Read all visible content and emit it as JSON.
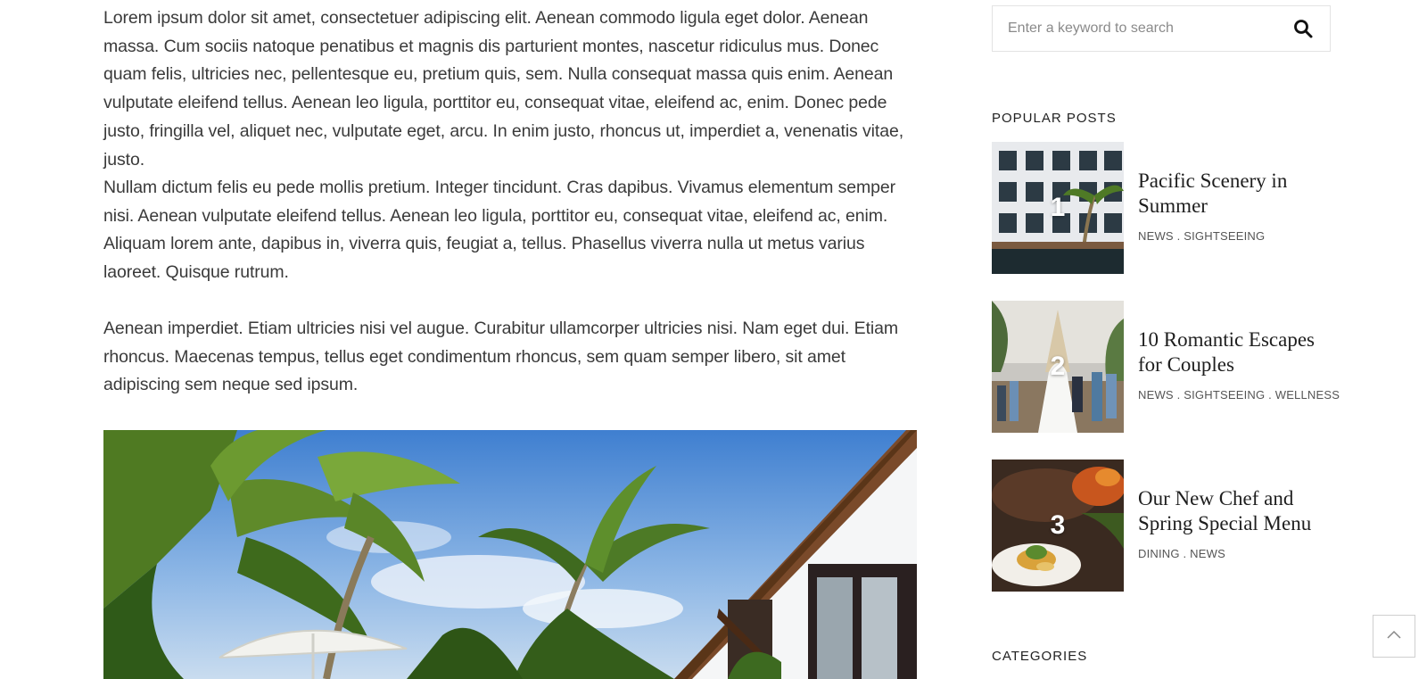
{
  "article": {
    "paragraphs": [
      "Lorem ipsum dolor sit amet, consectetuer adipiscing elit. Aenean commodo ligula eget dolor. Aenean massa. Cum sociis natoque penatibus et magnis dis parturient montes, nascetur ridiculus mus. Donec quam felis, ultricies nec, pellentesque eu, pretium quis, sem. Nulla consequat massa quis enim. Aenean vulputate eleifend tellus. Aenean leo ligula, porttitor eu, consequat vitae, eleifend ac, enim. Donec pede justo, fringilla vel, aliquet nec, vulputate eget, arcu. In enim justo, rhoncus ut, imperdiet a, venenatis vitae, justo.",
      "Nullam dictum felis eu pede mollis pretium. Integer tincidunt. Cras dapibus. Vivamus elementum semper nisi. Aenean vulputate eleifend tellus. Aenean leo ligula, porttitor eu, consequat vitae, eleifend ac, enim. Aliquam lorem ante, dapibus in, viverra quis, feugiat a, tellus. Phasellus viverra nulla ut metus varius laoreet. Quisque rutrum.",
      "Aenean imperdiet. Etiam ultricies nisi vel augue. Curabitur ullamcorper ultricies nisi. Nam eget dui. Etiam rhoncus. Maecenas tempus, tellus eget condimentum rhoncus, sem quam semper libero, sit amet adipiscing sem neque sed ipsum."
    ]
  },
  "search": {
    "placeholder": "Enter a keyword to search",
    "icon": "search-icon"
  },
  "popular_posts": {
    "heading": "POPULAR POSTS",
    "items": [
      {
        "number": "1",
        "title": "Pacific Scenery in Summer",
        "categories": "NEWS . SIGHTSEEING"
      },
      {
        "number": "2",
        "title": "10 Romantic Escapes for Couples",
        "categories": "NEWS . SIGHTSEEING . WELLNESS"
      },
      {
        "number": "3",
        "title": "Our New Chef and Spring Special Menu",
        "categories": "DINING . NEWS"
      }
    ]
  },
  "categories": {
    "heading": "CATEGORIES"
  },
  "back_to_top": {
    "icon": "chevron-up-icon"
  }
}
